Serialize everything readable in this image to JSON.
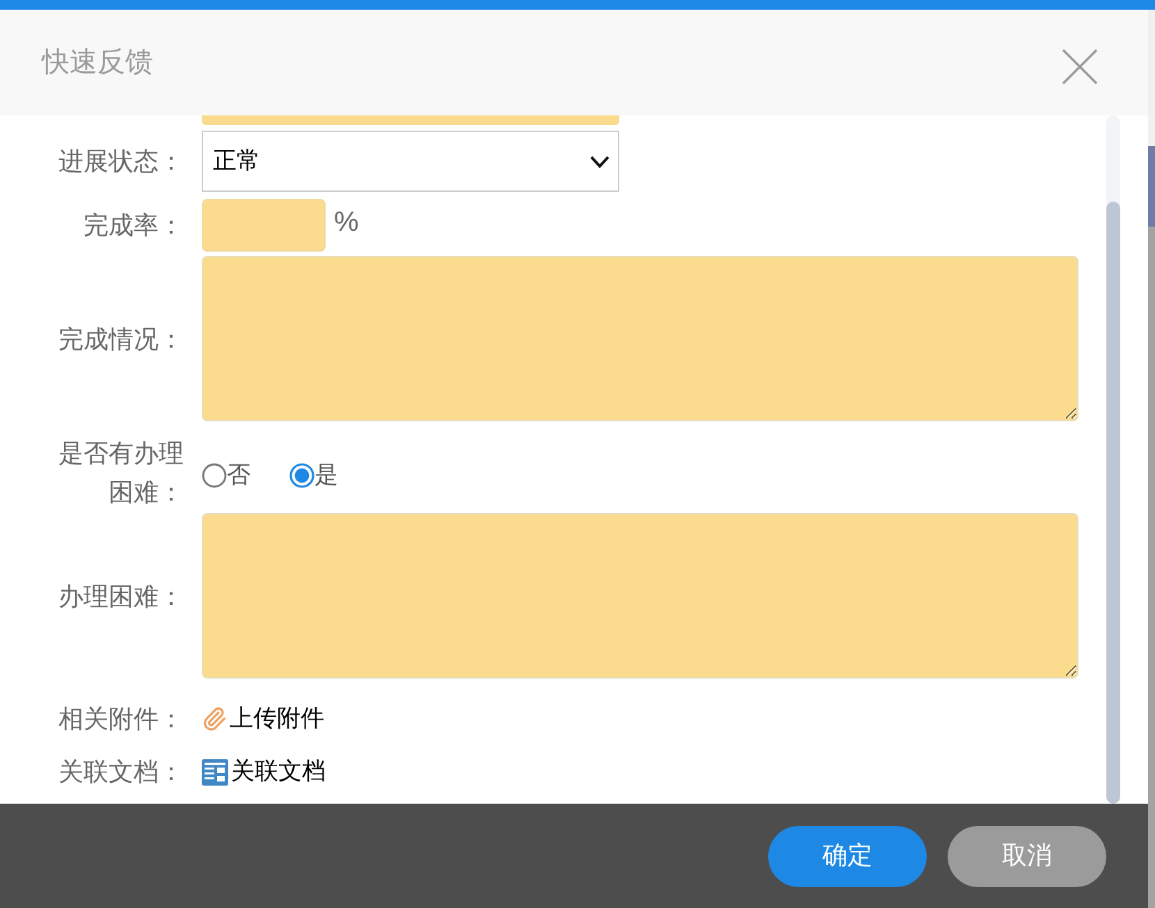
{
  "dialog": {
    "title": "快速反馈"
  },
  "form": {
    "fields": [
      {
        "kind": "partial_input"
      },
      {
        "kind": "select",
        "label": "进展状态：",
        "value": "正常"
      },
      {
        "kind": "percent",
        "label": "完成率：",
        "unit": "%"
      },
      {
        "kind": "textarea",
        "label": "完成情况："
      },
      {
        "kind": "radio",
        "label": "是否有办理困难：",
        "options": [
          {
            "label": "否",
            "selected": false
          },
          {
            "label": "是",
            "selected": true
          }
        ]
      },
      {
        "kind": "textarea",
        "label": "办理困难："
      },
      {
        "kind": "upload",
        "label": "相关附件：",
        "action": "上传附件"
      },
      {
        "kind": "link",
        "label": "关联文档：",
        "action": "关联文档"
      }
    ]
  },
  "buttons": [
    {
      "label": "确定",
      "kind": "primary"
    },
    {
      "label": "取消",
      "kind": "secondary"
    }
  ]
}
